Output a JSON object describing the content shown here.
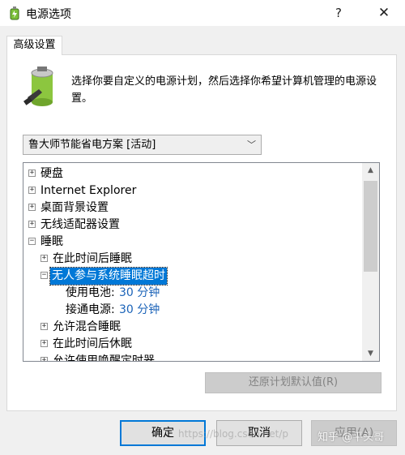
{
  "window": {
    "title": "电源选项",
    "help_glyph": "?",
    "close_glyph": "✕"
  },
  "tab": {
    "label": "高级设置"
  },
  "description": "选择你要自定义的电源计划，然后选择你希望计算机管理的电源设置。",
  "plan_select": {
    "value": "鲁大师节能省电方案 [活动]"
  },
  "tree": {
    "rows": [
      {
        "label": "硬盘",
        "expander": "+"
      },
      {
        "label": "Internet Explorer",
        "expander": "+"
      },
      {
        "label": "桌面背景设置",
        "expander": "+"
      },
      {
        "label": "无线适配器设置",
        "expander": "+"
      },
      {
        "label": "睡眠",
        "expander": "−"
      },
      {
        "label": "在此时间后睡眠",
        "expander": "+"
      },
      {
        "label": "无人参与系统睡眠超时",
        "expander": "−"
      },
      {
        "label": "使用电池:",
        "value": "30 分钟"
      },
      {
        "label": "接通电源:",
        "value": "30 分钟"
      },
      {
        "label": "允许混合睡眠",
        "expander": "+"
      },
      {
        "label": "在此时间后休眠",
        "expander": "+"
      },
      {
        "label": "允许使用唤醒定时器",
        "expander": "+"
      }
    ]
  },
  "buttons": {
    "restore": "还原计划默认值(R)",
    "ok": "确定",
    "cancel": "取消",
    "apply": "应用(A)"
  },
  "watermark": {
    "url": "https://blog.csdn.net/p",
    "author": "知乎 @平头哥"
  },
  "colors": {
    "selection": "#0078d7",
    "setting_value": "#1b63b8",
    "dialog_bg": "#f0f0f0"
  }
}
